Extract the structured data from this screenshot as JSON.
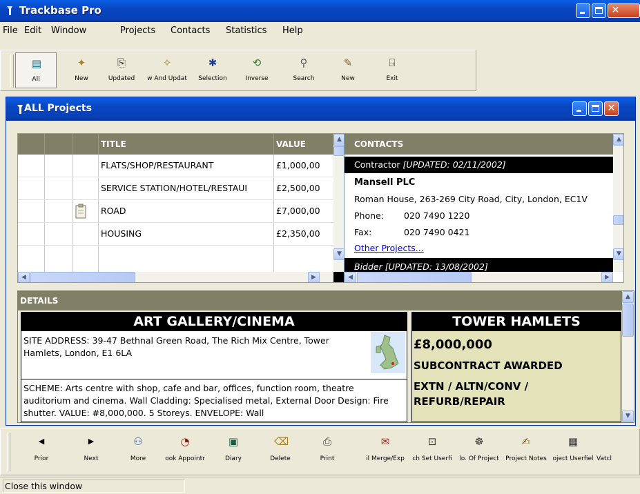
{
  "window": {
    "title": "Trackbase Pro"
  },
  "menu": [
    "File",
    "Edit",
    "Window",
    "Projects",
    "Contacts",
    "Statistics",
    "Help"
  ],
  "toolbar": [
    {
      "label": "All",
      "icon": "all-projects-icon",
      "glyph": "▤"
    },
    {
      "label": "New",
      "icon": "new-projects-icon",
      "glyph": "✦"
    },
    {
      "label": "Updated",
      "icon": "updated-icon",
      "glyph": "⎘"
    },
    {
      "label": "w And Updat",
      "icon": "new-and-updated-icon",
      "glyph": "✧"
    },
    {
      "label": "Selection",
      "icon": "selection-icon",
      "glyph": "✱"
    },
    {
      "label": "Inverse",
      "icon": "inverse-icon",
      "glyph": "⟲"
    },
    {
      "label": "Search",
      "icon": "search-icon",
      "glyph": "⚲"
    },
    {
      "label": "New",
      "icon": "new-search-icon",
      "glyph": "✎"
    },
    {
      "label": "Exit",
      "icon": "exit-icon",
      "glyph": "⍈"
    }
  ],
  "child": {
    "title": "ALL Projects",
    "grid": {
      "columns": [
        "TITLE",
        "VALUE"
      ],
      "rows": [
        {
          "title": "FLATS/SHOP/RESTAURANT",
          "value": "£1,000,00"
        },
        {
          "title": "SERVICE STATION/HOTEL/RESTAUI",
          "value": "£2,500,00"
        },
        {
          "title": "ROAD",
          "value": "£7,000,00"
        },
        {
          "title": "HOUSING",
          "value": "£2,350,00"
        }
      ]
    },
    "contacts": {
      "header": "CONTACTS",
      "role_bar": "Contractor ",
      "role_updated": "[UPDATED: 02/11/2002]",
      "company": "Mansell PLC",
      "address": "Roman House, 263-269 City Road, City, London, EC1V",
      "phone_label": "Phone:",
      "phone": "020 7490 1220",
      "fax_label": "Fax:",
      "fax": "020 7490  0421",
      "other_link": "Other Projects...",
      "next_bar": "Bidder  [UPDATED: 13/08/2002]"
    },
    "details": {
      "header": "DETAILS",
      "title": "ART GALLERY/CINEMA",
      "site_address": "SITE ADDRESS: 39-47 Bethnal Green Road, The Rich Mix Centre, Tower Hamlets, London, E1 6LA",
      "scheme": "SCHEME: Arts centre with shop, cafe and bar, offices, function room, theatre auditorium and cinema.  Wall Cladding: Specialised metal, External Door Design: Fire shutter.  VALUE: #8,000,000. 5 Storeys.  ENVELOPE: Wall",
      "region": "TOWER HAMLETS",
      "value": "£8,000,000",
      "status": "SUBCONTRACT AWARDED",
      "type": "EXTN / ALTN/CONV / REFURB/REPAIR"
    }
  },
  "bottom_toolbar": [
    {
      "label": "Prior",
      "icon": "prior-arrow-icon",
      "glyph": "◀"
    },
    {
      "label": "Next",
      "icon": "next-arrow-icon",
      "glyph": "▶"
    },
    {
      "label": "More",
      "icon": "more-icon",
      "glyph": "⚇"
    },
    {
      "label": "ook Appointr",
      "icon": "book-appointment-icon",
      "glyph": "◔"
    },
    {
      "label": "Diary",
      "icon": "diary-icon",
      "glyph": "▣"
    },
    {
      "label": "Delete",
      "icon": "delete-icon",
      "glyph": "⌫"
    },
    {
      "label": "Print",
      "icon": "print-icon",
      "glyph": "⎙"
    },
    {
      "label": "il Merge/Exp",
      "icon": "mail-merge-icon",
      "glyph": "✉"
    },
    {
      "label": "ch Set Userfi",
      "icon": "batch-set-userfield-icon",
      "glyph": "⊡"
    },
    {
      "label": "lo. Of Project",
      "icon": "no-of-projects-icon",
      "glyph": "☸"
    },
    {
      "label": "Project Notes",
      "icon": "project-notes-icon",
      "glyph": "✍"
    },
    {
      "label": "oject Userfiel",
      "icon": "project-userfield-icon",
      "glyph": "▦"
    },
    {
      "label": "Vatcl",
      "icon": "watch-icon",
      "glyph": ""
    }
  ],
  "status": {
    "text": "Close this window"
  }
}
